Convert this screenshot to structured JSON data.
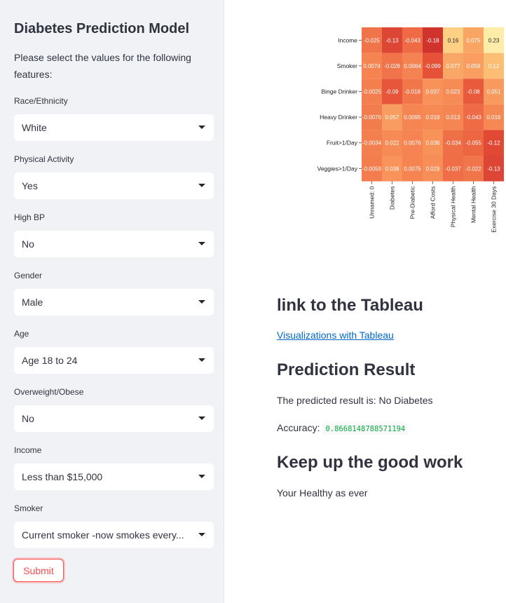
{
  "sidebar": {
    "title": "Diabetes Prediction Model",
    "description": "Please select the values for the following features:",
    "fields": [
      {
        "label": "Race/Ethnicity",
        "value": "White"
      },
      {
        "label": "Physical Activity",
        "value": "Yes"
      },
      {
        "label": "High BP",
        "value": "No"
      },
      {
        "label": "Gender",
        "value": "Male"
      },
      {
        "label": "Age",
        "value": "Age 18 to 24"
      },
      {
        "label": "Overweight/Obese",
        "value": "No"
      },
      {
        "label": "Income",
        "value": "Less than $15,000"
      },
      {
        "label": "Smoker",
        "value": "Current smoker -now smokes every..."
      }
    ],
    "submit_label": "Submit"
  },
  "main": {
    "tableau_heading": "link to the Tableau",
    "tableau_link": "Visualizations with Tableau",
    "prediction_heading": "Prediction Result",
    "prediction_text": "The predicted result is: No Diabetes",
    "accuracy_label": "Accuracy:",
    "accuracy_value": "0.8668148788571194",
    "encourage_heading": "Keep up the good work",
    "encourage_text": "Your Healthy as ever"
  },
  "chart_data": {
    "type": "heatmap",
    "rows": [
      "Income",
      "Smoker",
      "Binge Drinker",
      "Heavy Drinker",
      "Fruit>1/Day",
      "Veggies>1/Day"
    ],
    "columns": [
      "Unnamed: 0",
      "Diabetes",
      "Pre-Diabetic",
      "Afford Costs",
      "Physical Health",
      "Mental Health",
      "Exercise 30 Days"
    ],
    "labels": [
      [
        "-0.025",
        "-0.13",
        "-0.043",
        "-0.18",
        "0.16",
        "0.075",
        "0.23"
      ],
      [
        "0.0074",
        "-0.028",
        "0.0064",
        "-0.099",
        "0.077",
        "0.059",
        "0.12"
      ],
      [
        "-0.0025",
        "-0.09",
        "-0.018",
        "0.037",
        "0.023",
        "-0.08",
        "0.051"
      ],
      [
        "-0.0076",
        "0.057",
        "0.0095",
        "0.018",
        "0.013",
        "-0.043",
        "0.016"
      ],
      [
        "-0.0034",
        "0.022",
        "0.0076",
        "0.036",
        "-0.034",
        "-0.055",
        "-0.12"
      ],
      [
        "-0.0059",
        "0.038",
        "0.0075",
        "0.029",
        "-0.037",
        "-0.022",
        "-0.13"
      ]
    ],
    "values": [
      [
        -0.025,
        -0.13,
        -0.043,
        -0.18,
        0.16,
        0.075,
        0.23
      ],
      [
        0.0074,
        -0.028,
        0.0064,
        -0.099,
        0.077,
        0.059,
        0.12
      ],
      [
        -0.0025,
        -0.09,
        -0.018,
        0.037,
        0.023,
        -0.08,
        0.051
      ],
      [
        -0.0076,
        0.057,
        0.0095,
        0.018,
        0.013,
        -0.043,
        0.016
      ],
      [
        -0.0034,
        0.022,
        0.0076,
        0.036,
        -0.034,
        -0.055,
        -0.12
      ],
      [
        -0.0059,
        0.038,
        0.0075,
        0.029,
        -0.037,
        -0.022,
        -0.13
      ]
    ],
    "colormap": "YlOrRd",
    "vmin": -0.2,
    "vmax": 0.25
  },
  "colors": {
    "accent": "#ff4b4b",
    "sidebar_bg": "#f0f2f6",
    "link": "#0068c9",
    "code_text": "#09ab3b"
  },
  "icons": {
    "select_caret": "chevron-down-icon"
  }
}
